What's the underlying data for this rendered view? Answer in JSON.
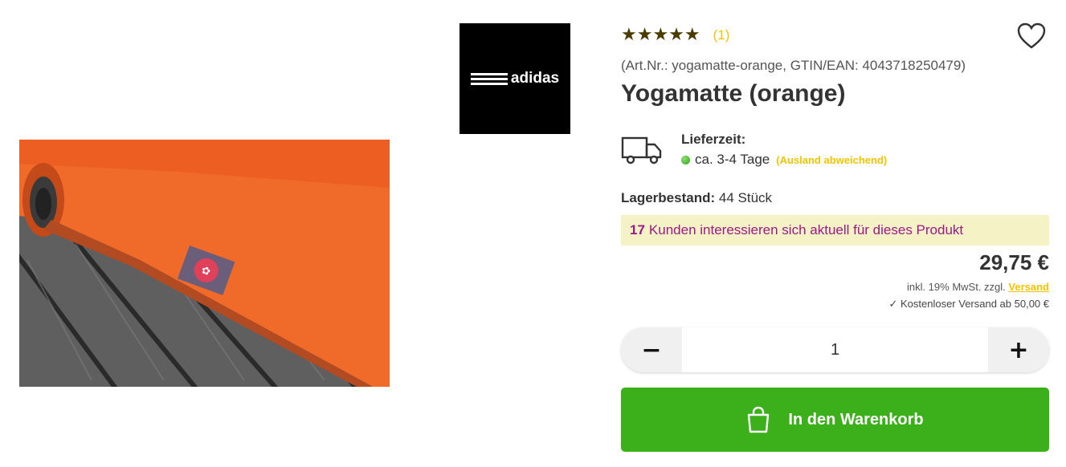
{
  "brand": {
    "name": "adidas"
  },
  "product": {
    "rating": {
      "stars": "★★★★★",
      "count": "(1)"
    },
    "sku_line": "(Art.Nr.: yogamatte-orange, GTIN/EAN: 4043718250479)",
    "title": "Yogamatte (orange)"
  },
  "delivery": {
    "label": "Lieferzeit:",
    "time": "ca. 3-4 Tage",
    "note": "(Ausland abweichend)"
  },
  "stock": {
    "label": "Lagerbestand:",
    "value": "44 Stück"
  },
  "interest": {
    "count": "17",
    "text": "Kunden interessieren sich aktuell für dieses Produkt"
  },
  "pricing": {
    "price": "29,75 €",
    "tax_text": "inkl. 19% MwSt. zzgl.",
    "shipping_link": "Versand",
    "free_shipping": "✓ Kostenloser Versand ab 50,00 €"
  },
  "quantity": {
    "minus": "−",
    "value": "1",
    "plus": "+"
  },
  "cart": {
    "label": "In den Warenkorb"
  },
  "colors": {
    "accent_green": "#3bb01b",
    "accent_yellow": "#f2c400",
    "interest_text": "#9b1a86",
    "mat_orange": "#f06a2a"
  }
}
